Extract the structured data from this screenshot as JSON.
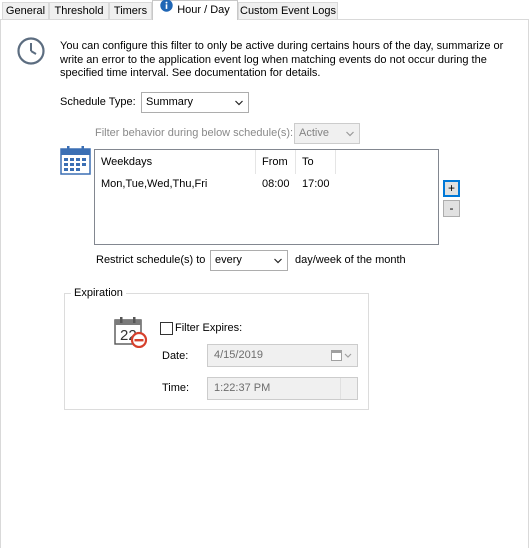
{
  "tabs": [
    {
      "label": "General"
    },
    {
      "label": "Threshold"
    },
    {
      "label": "Timers"
    },
    {
      "label": "Hour / Day"
    },
    {
      "label": "Custom Event Logs"
    }
  ],
  "icons": {
    "info": "info-icon",
    "clock": "clock-icon",
    "calendar": "calendar-icon",
    "calendar_remove": "calendar-remove-icon"
  },
  "description": "You can configure this filter to only be active during certains hours of the day, summarize or write an error to the application event log when matching events do not occur during the specified time interval. See documentation for details.",
  "schedule_type": {
    "label": "Schedule Type:",
    "value": "Summary"
  },
  "filter_behavior": {
    "label": "Filter behavior during below schedule(s):",
    "value": "Active"
  },
  "schedule_table": {
    "columns": [
      "Weekdays",
      "From",
      "To"
    ],
    "rows": [
      {
        "weekdays": "Mon,Tue,Wed,Thu,Fri",
        "from": "08:00",
        "to": "17:00"
      }
    ]
  },
  "buttons": {
    "add": "+",
    "remove": "-"
  },
  "restrict": {
    "label": "Restrict schedule(s) to",
    "value": "every",
    "suffix": "day/week of the month"
  },
  "expiration": {
    "legend": "Expiration",
    "checkbox_label": "Filter Expires:",
    "date_label": "Date:",
    "date_value": "4/15/2019",
    "time_label": "Time:",
    "time_value": "1:22:37 PM",
    "calendar_day": "22"
  },
  "colors": {
    "focus_blue": "#0078d7",
    "info_blue": "#1f66b5",
    "calendar_blue": "#3b6fb4",
    "remove_red": "#d6402c"
  }
}
